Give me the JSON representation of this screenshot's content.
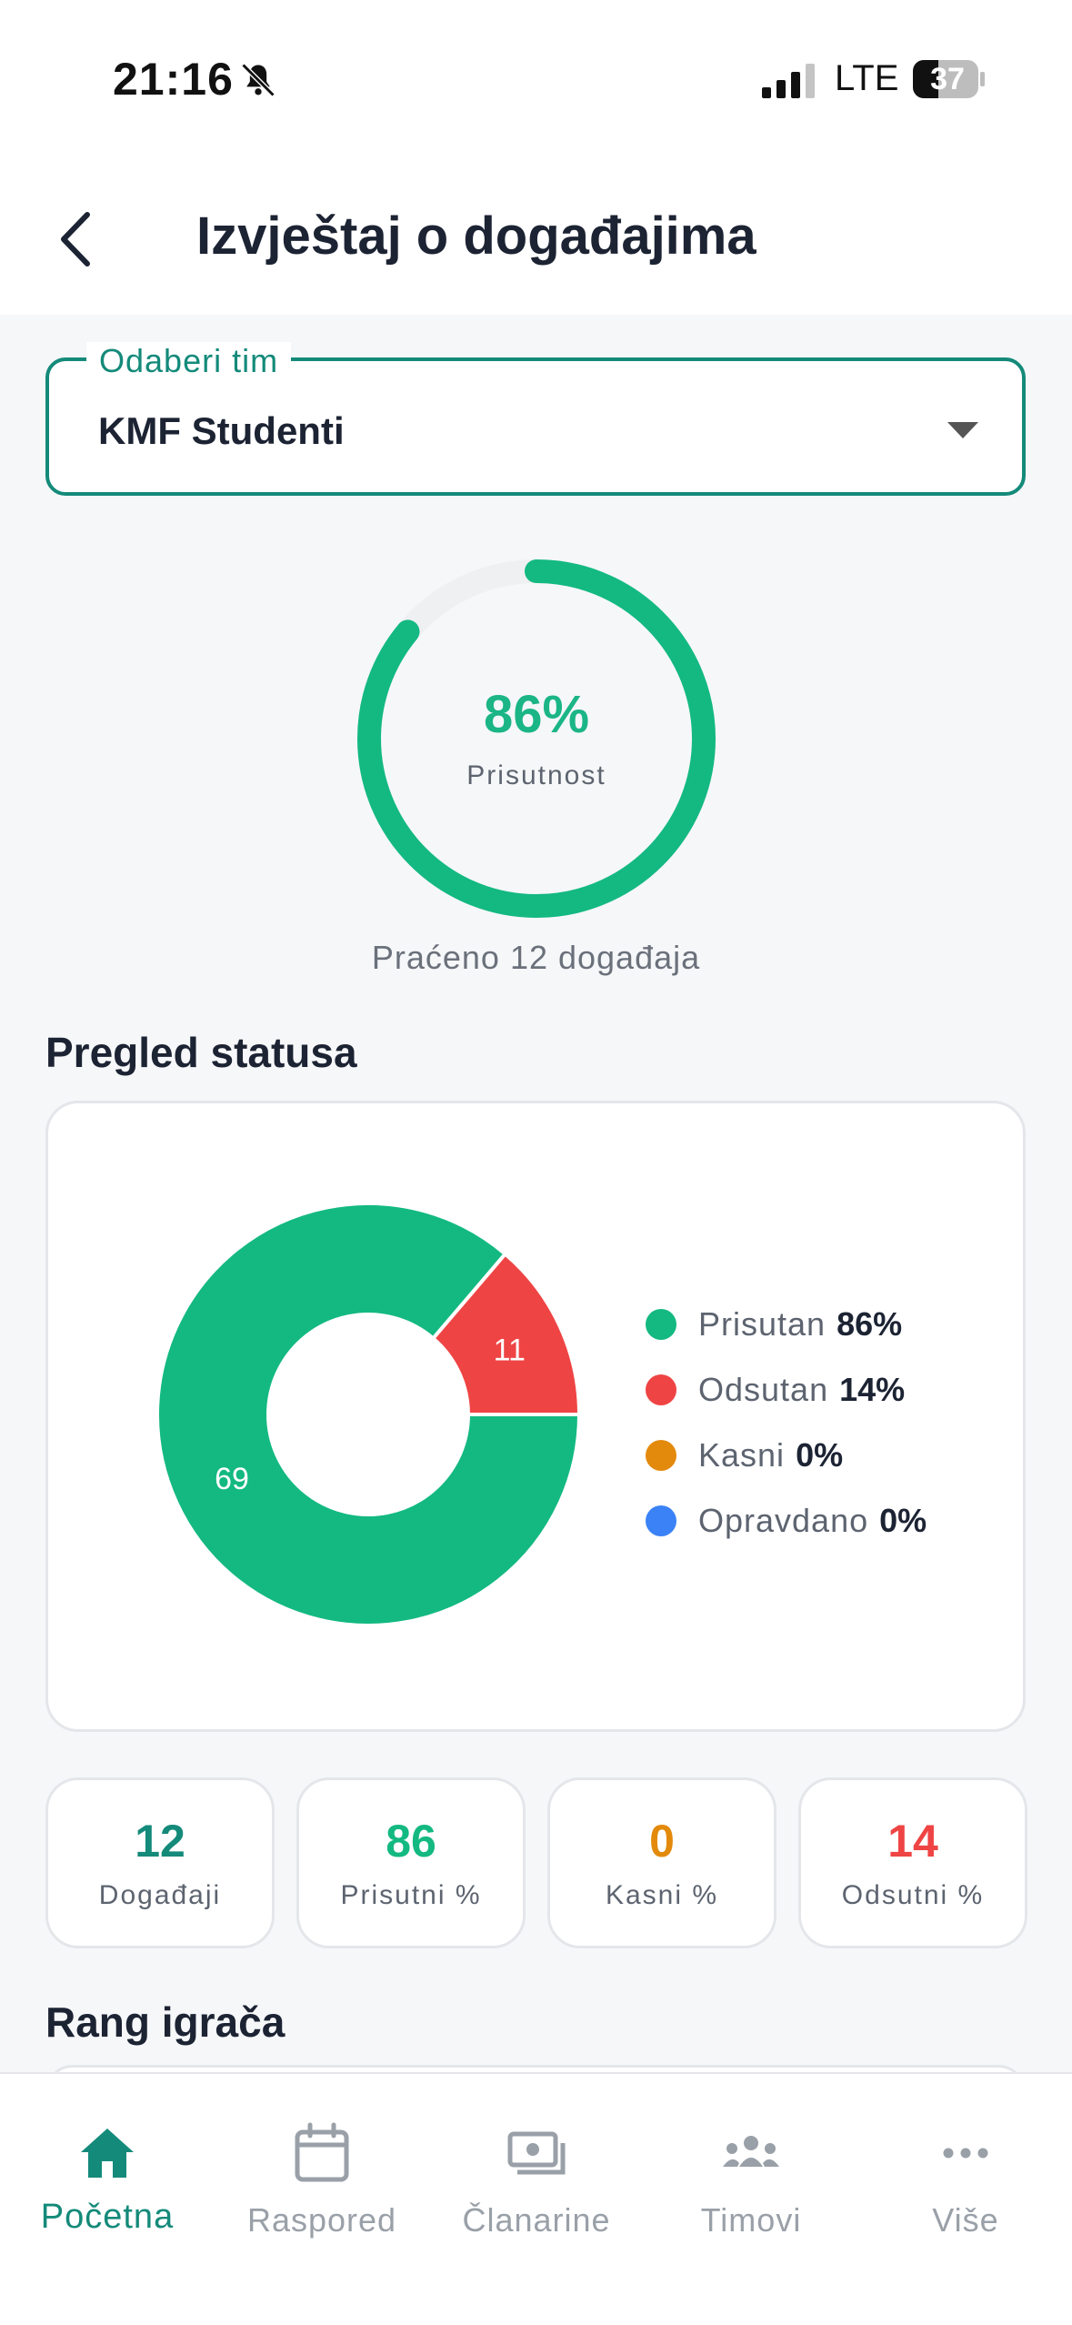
{
  "status_bar": {
    "time": "21:16",
    "network": "LTE",
    "battery": "37"
  },
  "header": {
    "title": "Izvještaj o događajima"
  },
  "team_select": {
    "legend": "Odaberi tim",
    "value": "KMF Studenti"
  },
  "attendance": {
    "percent_label": "86%",
    "caption": "Prisutnost",
    "tracked": "Praćeno 12 događaja",
    "fraction": 0.86
  },
  "status_overview": {
    "title": "Pregled statusa",
    "legend": [
      {
        "label": "Prisutan",
        "pct": "86%",
        "color": "#13b981"
      },
      {
        "label": "Odsutan",
        "pct": "14%",
        "color": "#ef4444"
      },
      {
        "label": "Kasni",
        "pct": "0%",
        "color": "#e38a0c"
      },
      {
        "label": "Opravdano",
        "pct": "0%",
        "color": "#3b82f6"
      }
    ]
  },
  "chart_data": {
    "type": "pie",
    "categories": [
      "Prisutan",
      "Odsutan",
      "Kasni",
      "Opravdano"
    ],
    "values": [
      69,
      11,
      0,
      0
    ],
    "slice_labels": [
      "69",
      "11"
    ],
    "colors": [
      "#13b981",
      "#ef4444",
      "#e38a0c",
      "#3b82f6"
    ]
  },
  "stats": [
    {
      "value": "12",
      "label": "Događaji",
      "color": "#148a7a"
    },
    {
      "value": "86",
      "label": "Prisutni %",
      "color": "#13b981"
    },
    {
      "value": "0",
      "label": "Kasni %",
      "color": "#e38a0c"
    },
    {
      "value": "14",
      "label": "Odsutni %",
      "color": "#ef4444"
    }
  ],
  "ranking": {
    "title": "Rang igrača"
  },
  "tabs": [
    {
      "label": "Početna",
      "icon": "home-icon",
      "active": true
    },
    {
      "label": "Raspored",
      "icon": "calendar-icon",
      "active": false
    },
    {
      "label": "Članarine",
      "icon": "payments-icon",
      "active": false
    },
    {
      "label": "Timovi",
      "icon": "teams-icon",
      "active": false
    },
    {
      "label": "Više",
      "icon": "more-icon",
      "active": false
    }
  ]
}
